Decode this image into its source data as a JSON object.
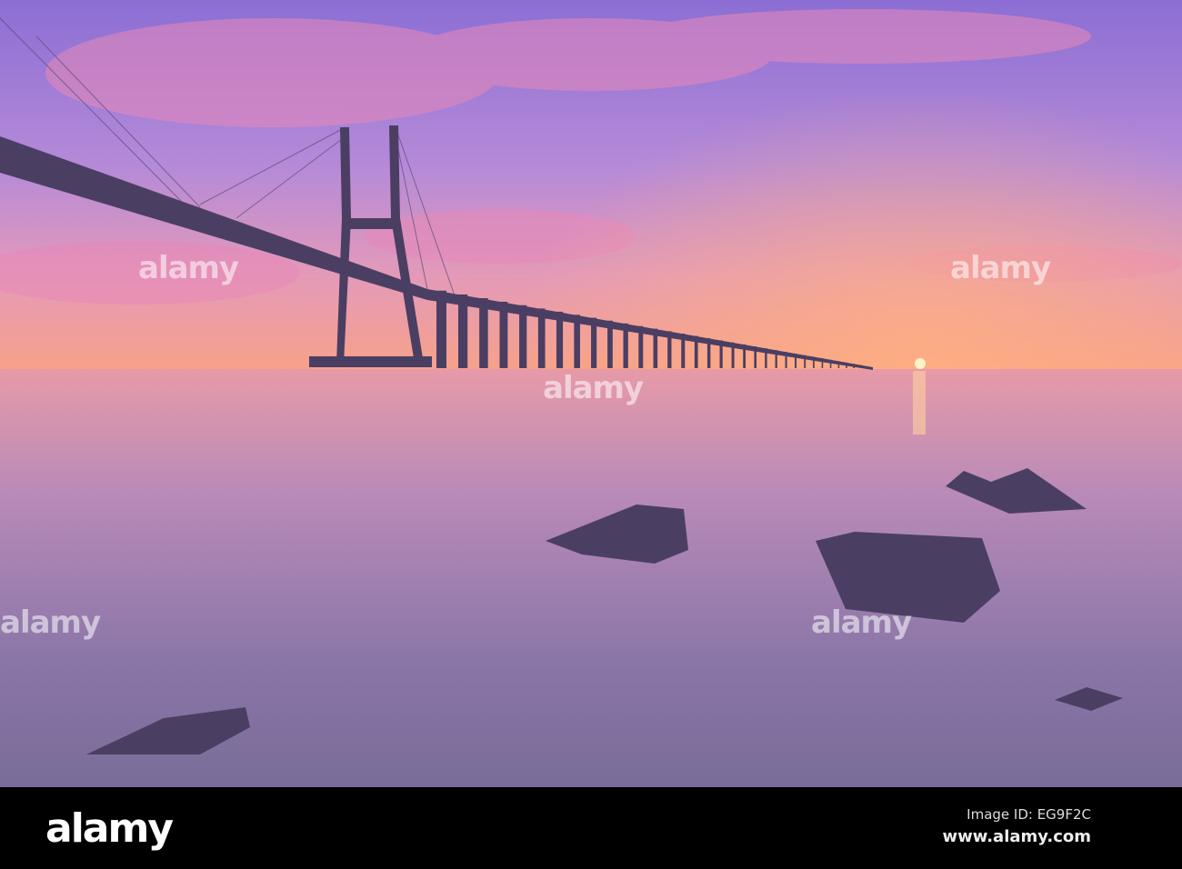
{
  "watermark": {
    "text": "alamy"
  },
  "footer": {
    "logo": "alamy",
    "image_id": "Image ID: EG9F2C",
    "website": "www.alamy.com"
  },
  "colors": {
    "sky_top": "#8a6fd0",
    "sky_horizon": "#f29a8a",
    "water": "#9a7fb8",
    "footer_bg": "#000000"
  }
}
